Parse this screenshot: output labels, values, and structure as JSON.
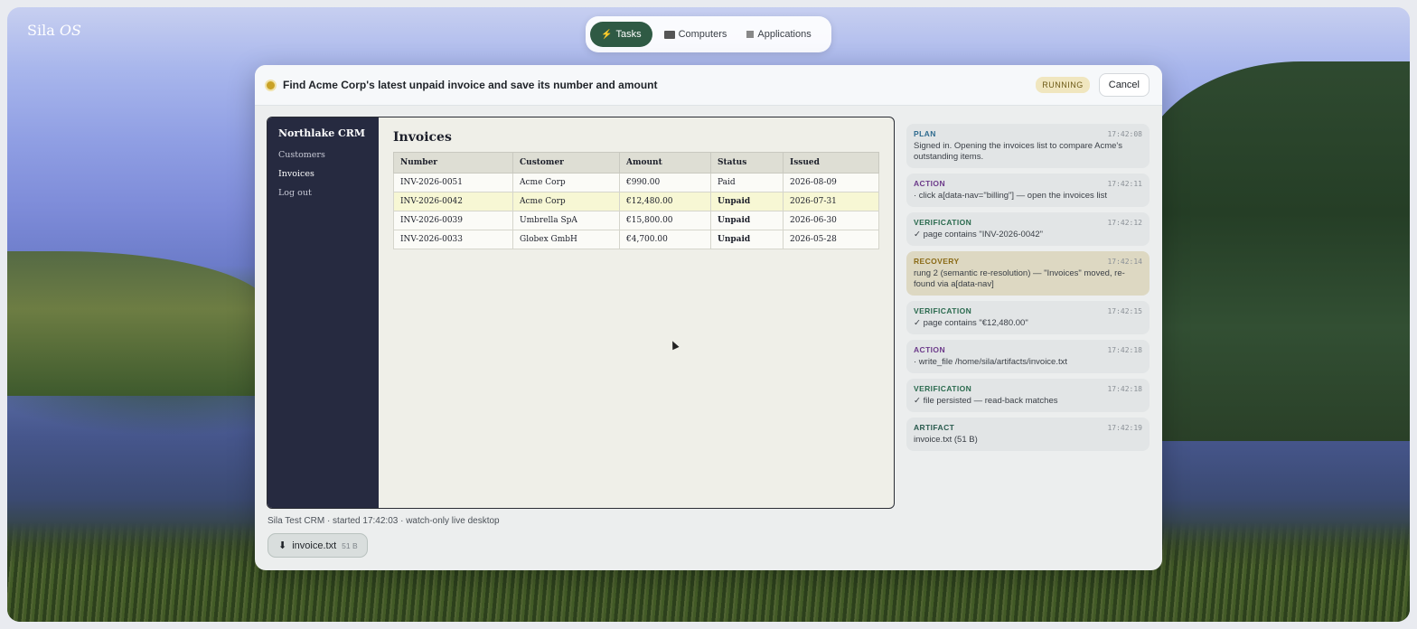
{
  "os": {
    "logo_main": "Sila",
    "logo_em": "OS"
  },
  "topbar": {
    "tabs": [
      {
        "label": "Tasks",
        "icon": "lightning-icon",
        "active": true
      },
      {
        "label": "Computers",
        "icon": "monitor-icon",
        "active": false
      },
      {
        "label": "Applications",
        "icon": "grid-icon",
        "active": false
      }
    ]
  },
  "task": {
    "title": "Find Acme Corp's latest unpaid invoice and save its number and amount",
    "status": "RUNNING",
    "cancel_label": "Cancel",
    "status_color": "#c9a227"
  },
  "crm": {
    "brand": "Northlake CRM",
    "nav": [
      "Customers",
      "Invoices",
      "Log out"
    ],
    "heading": "Invoices",
    "columns": [
      "Number",
      "Customer",
      "Amount",
      "Status",
      "Issued"
    ],
    "rows": [
      {
        "number": "INV-2026-0051",
        "customer": "Acme Corp",
        "amount": "€990.00",
        "status": "Paid",
        "issued": "2026-08-09"
      },
      {
        "number": "INV-2026-0042",
        "customer": "Acme Corp",
        "amount": "€12,480.00",
        "status": "Unpaid",
        "issued": "2026-07-31"
      },
      {
        "number": "INV-2026-0039",
        "customer": "Umbrella SpA",
        "amount": "€15,800.00",
        "status": "Unpaid",
        "issued": "2026-06-30"
      },
      {
        "number": "INV-2026-0033",
        "customer": "Globex GmbH",
        "amount": "€4,700.00",
        "status": "Unpaid",
        "issued": "2026-05-28"
      }
    ]
  },
  "footer": {
    "note": "Sila Test CRM · started 17:42:03 · watch-only live desktop",
    "artifact_name": "invoice.txt",
    "artifact_size": "51 B"
  },
  "log": [
    {
      "kind": "PLAN",
      "time": "17:42:08",
      "text": "Signed in. Opening the invoices list to compare Acme's outstanding items."
    },
    {
      "kind": "ACTION",
      "time": "17:42:11",
      "text": "· click a[data-nav=\"billing\"] — open the invoices list"
    },
    {
      "kind": "VERIFICATION",
      "time": "17:42:12",
      "text": "✓ page contains \"INV-2026-0042\""
    },
    {
      "kind": "RECOVERY",
      "time": "17:42:14",
      "text": "rung 2 (semantic re-resolution) — \"Invoices\" moved, re-found via a[data-nav]"
    },
    {
      "kind": "VERIFICATION",
      "time": "17:42:15",
      "text": "✓ page contains \"€12,480.00\""
    },
    {
      "kind": "ACTION",
      "time": "17:42:18",
      "text": "· write_file /home/sila/artifacts/invoice.txt"
    },
    {
      "kind": "VERIFICATION",
      "time": "17:42:18",
      "text": "✓ file persisted — read-back matches"
    },
    {
      "kind": "ARTIFACT",
      "time": "17:42:19",
      "text": "invoice.txt (51 B)"
    }
  ]
}
